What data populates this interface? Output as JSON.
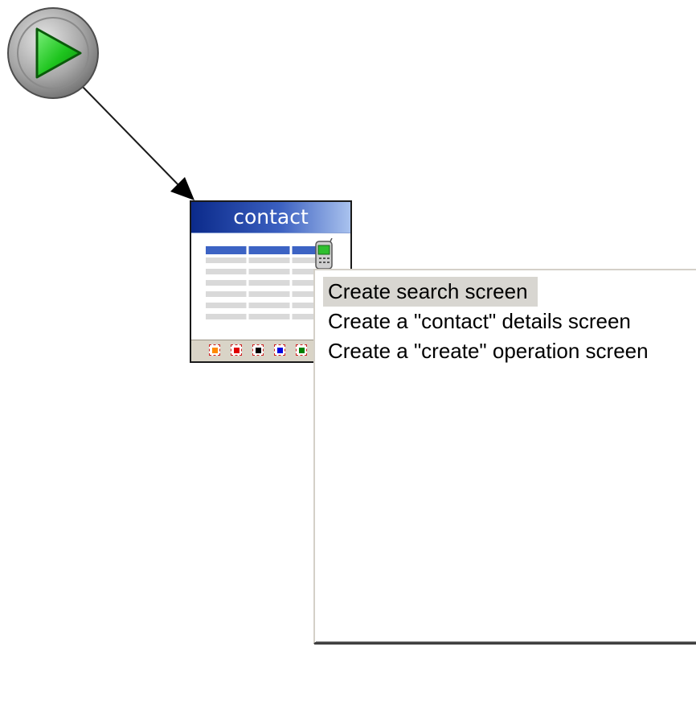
{
  "diagram": {
    "start_node": {
      "icon": "play-icon",
      "label": ""
    },
    "screen_node": {
      "title": "contact",
      "thumbnail_icon": "table-icon",
      "device_icon": "mobile-phone-icon",
      "ports": [
        {
          "color": "#ff8a00",
          "name": "orange-port"
        },
        {
          "color": "#e00000",
          "name": "red-port"
        },
        {
          "color": "#000000",
          "name": "black-port"
        },
        {
          "color": "#0000e0",
          "name": "blue-port"
        },
        {
          "color": "#008000",
          "name": "green-port"
        }
      ]
    },
    "connector": {
      "from": "start_node",
      "to": "screen_node"
    }
  },
  "context_menu": {
    "items": [
      {
        "label": "Create search screen",
        "selected": true
      },
      {
        "label": "Create a \"contact\" details screen",
        "selected": false
      },
      {
        "label": "Create a \"create\" operation screen",
        "selected": false
      }
    ]
  },
  "colors": {
    "title_bar_start": "#0b2a8a",
    "title_bar_end": "#a9c2ee",
    "play_green": "#19c219",
    "menu_highlight": "#d8d6d1"
  }
}
